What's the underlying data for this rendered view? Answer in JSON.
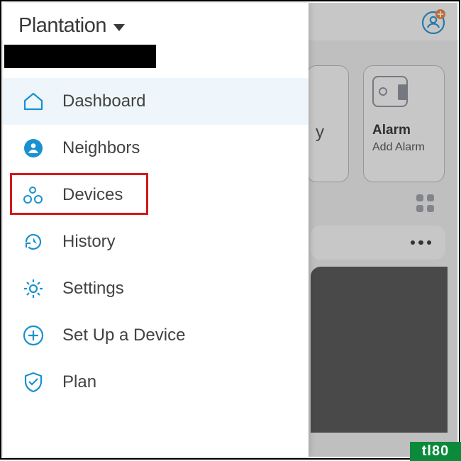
{
  "location": {
    "title": "Plantation"
  },
  "sidebar": {
    "items": [
      {
        "label": "Dashboard"
      },
      {
        "label": "Neighbors"
      },
      {
        "label": "Devices"
      },
      {
        "label": "History"
      },
      {
        "label": "Settings"
      },
      {
        "label": "Set Up a Device"
      },
      {
        "label": "Plan"
      }
    ],
    "active_index": 0,
    "highlighted_index": 2
  },
  "background": {
    "history_peek": "y",
    "alarm": {
      "title": "Alarm",
      "subtitle": "Add Alarm"
    }
  },
  "watermark": "tl80"
}
